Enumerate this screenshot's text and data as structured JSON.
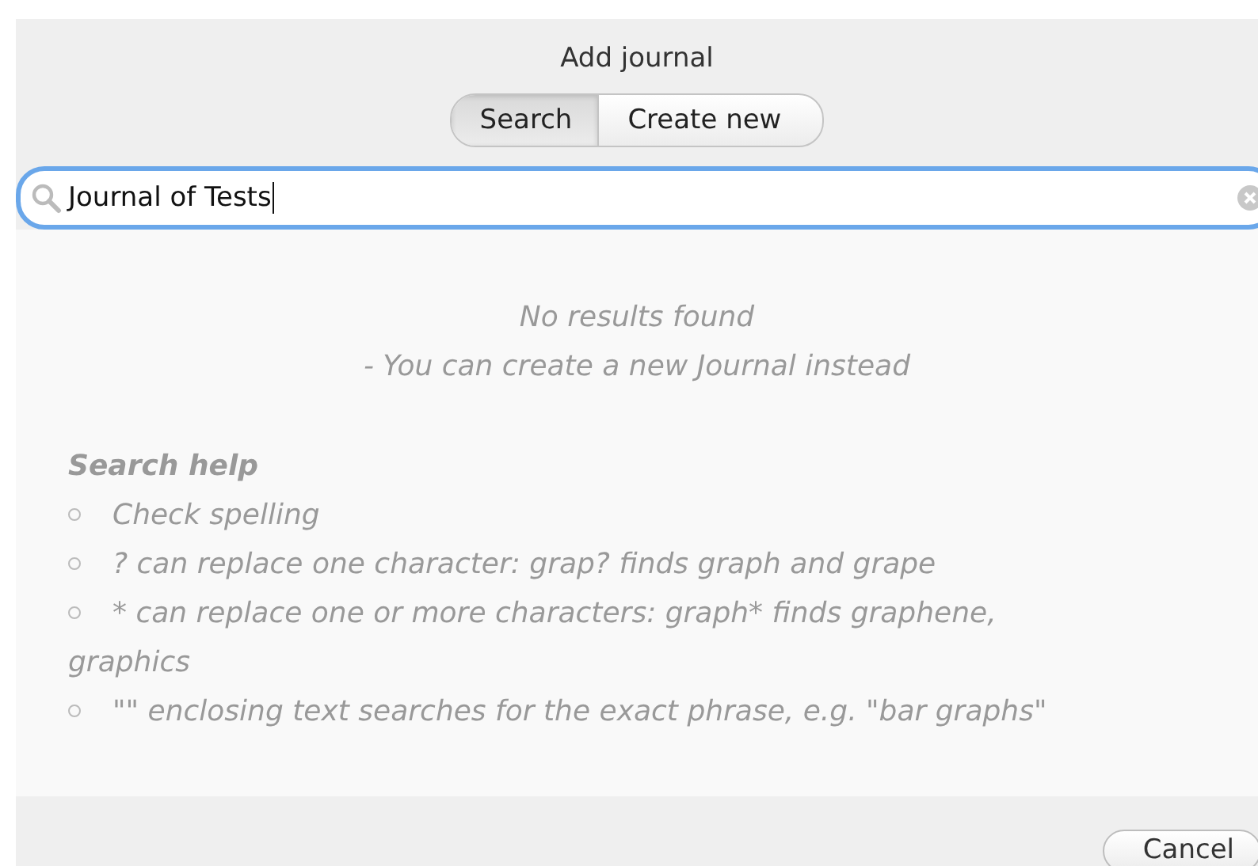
{
  "dialog": {
    "title": "Add journal"
  },
  "tabs": [
    {
      "label": "Search",
      "selected": true
    },
    {
      "label": "Create new",
      "selected": false
    }
  ],
  "search": {
    "value": "Journal of Tests",
    "focused": true
  },
  "results": {
    "message": "No results found",
    "hint": "- You can create a new Journal instead"
  },
  "help": {
    "title": "Search help",
    "items": [
      {
        "text": "Check spelling"
      },
      {
        "text": "? can replace one character: grap? finds graph and grape"
      },
      {
        "text": "* can replace one or more characters: graph* finds graphene, graphics"
      },
      {
        "text": "\"\" enclosing text searches for the exact phrase, e.g. \"bar graphs\""
      }
    ]
  },
  "buttons": [
    {
      "label": "Cancel"
    }
  ]
}
